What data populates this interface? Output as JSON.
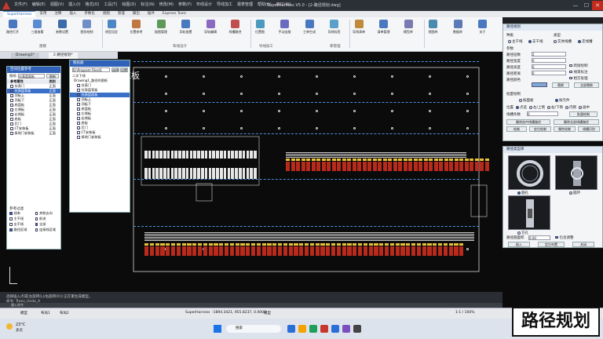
{
  "app": {
    "title": "SuperHarness V5.0 - [2-路径规划.dwg]",
    "menu": [
      "文件(F)",
      "编辑(E)",
      "视图(V)",
      "插入(I)",
      "格式(O)",
      "工具(T)",
      "绘图(D)",
      "标注(N)",
      "修改(M)",
      "参数(P)",
      "布线设计",
      "导线加工",
      "报表管理",
      "帮助(H)",
      "窗口(W)"
    ],
    "window_controls": [
      "—",
      "☐",
      "✕"
    ]
  },
  "ribbon": {
    "tabs": [
      "SuperHarness",
      "常用",
      "注释",
      "插入",
      "参数化",
      "视图",
      "管理",
      "输出",
      "插件",
      "Express Tools"
    ],
    "active_tab": "SuperHarness",
    "buttons": [
      "路径打开",
      "三维查看",
      "参数设置",
      "图形绘制",
      "线型设定",
      "位置参考",
      "插图管理",
      "导轨放置",
      "导轨编辑",
      "线槽路径",
      "位置图",
      "手动连接",
      "工单生成",
      "导线标签",
      "导线清单",
      "清单管理",
      "模型库",
      "视图库",
      "数据库",
      "关于"
    ],
    "groups": [
      "建模",
      "布线设计",
      "导线加工",
      "库管理"
    ]
  },
  "doc_tabs": [
    "Drawing1*",
    "2-路径规划*"
  ],
  "canvas": {
    "title_text": "底板",
    "crosshair_label": "Y"
  },
  "left_panel": {
    "title": "空间位置参考",
    "view_label": "图纸:",
    "view_value": "仪表盘面板",
    "refresh_btn": "刷新",
    "columns": [
      "参考属性",
      "类别"
    ],
    "rows": [
      {
        "name": "仪表门",
        "type": "正面"
      },
      {
        "name": "仪表盘背板",
        "type": "正面"
      },
      {
        "name": "顶板上",
        "type": "正面"
      },
      {
        "name": "顶板下",
        "type": "正面"
      },
      {
        "name": "底盘板",
        "type": "正面"
      },
      {
        "name": "左侧板",
        "type": "正面"
      },
      {
        "name": "右侧板",
        "type": "正面"
      },
      {
        "name": "底板",
        "type": "正面"
      },
      {
        "name": "后门",
        "type": "正面"
      },
      {
        "name": "CT安装板",
        "type": "正面"
      },
      {
        "name": "接地门安装板",
        "type": "正面"
      }
    ],
    "selected_index": 1,
    "filter_title": "参考过滤",
    "filters": [
      {
        "label": "线束",
        "checked": true
      },
      {
        "label": "关联去向",
        "checked": false
      },
      {
        "label": "主干线",
        "checked": false
      },
      {
        "label": "前进",
        "checked": false
      },
      {
        "label": "支干线",
        "checked": false
      },
      {
        "label": "全部",
        "checked": true
      },
      {
        "label": "路径区域",
        "checked": true
      },
      {
        "label": "连接线区域",
        "checked": false
      }
    ]
  },
  "layer_panel": {
    "title": "图层器",
    "path_label": "D:\\Program Files\\S",
    "browse": "选择",
    "settings": "设置",
    "root": "Drawing1_路径的图纸",
    "items": [
      "仪表门",
      "仪表盘背板",
      "仪表盘面板",
      "顶板上",
      "顶板下",
      "底盘板",
      "左侧板",
      "右侧板",
      "底板",
      "后门",
      "CT安装板",
      "接地门安装板"
    ],
    "selected_index": 2,
    "header": "二次下线"
  },
  "right_panel": {
    "title": "路径规划",
    "type_label": "种类",
    "kind_label": "类型",
    "kinds": [
      {
        "label": "主干线",
        "on": false
      },
      {
        "label": "支干线",
        "on": true
      }
    ],
    "types": [
      {
        "label": "实体线槽",
        "on": false
      },
      {
        "label": "走线槽",
        "on": true
      }
    ],
    "params_label": "参数",
    "fields": [
      {
        "label": "路径层数",
        "value": "2"
      },
      {
        "label": "路径宽度",
        "value": "0"
      },
      {
        "label": "路径高度",
        "value": "0"
      },
      {
        "label": "路径距离",
        "value": "0"
      },
      {
        "label": "路径颜色",
        "value": ""
      }
    ],
    "checks": [
      "跨接绘制",
      "线束标注",
      "相交处理"
    ],
    "color_btn": "替换",
    "replace_all_btn": "全部替换",
    "draw_label": "批量绘制",
    "draw_opts": [
      {
        "label": "按面板",
        "on": false
      },
      {
        "label": "按元件",
        "on": true
      }
    ],
    "pos_label": "位置",
    "pos_opts": [
      "点选",
      "左/上侧",
      "右/下侧",
      "内侧",
      "居中"
    ],
    "pos_on": "点选",
    "wire_count_label": "线槽条数",
    "wire_count": "0",
    "batch_btn": "批量绘制",
    "actions": [
      "删除选中线槽路径",
      "删除全部线槽路径",
      "绘制",
      "定位绘制",
      "属性绘制",
      "线槽识别"
    ]
  },
  "image_panel": {
    "title": "路径类型库",
    "options": [
      {
        "label": "圆孔",
        "on": true
      },
      {
        "label": "圆环",
        "on": false
      },
      {
        "label": "方孔",
        "on": false
      }
    ],
    "size_label": "路径圆面积",
    "size_value": "0.00",
    "bind_check": "包含调整",
    "buttons": [
      "插入",
      "定位布置",
      "关闭"
    ]
  },
  "command": {
    "line1": "选择插入点或[左旋转(L)/右旋转(R)]:正在重生成模型。",
    "line2": "命令: Trans_Undo_A",
    "prompt": "键入命令"
  },
  "status": {
    "tabs": [
      "模型",
      "布局1",
      "布局2"
    ],
    "app": "SuperHarness",
    "coords": "-1894.3421, 955.8237, 0.0000",
    "mode": "模型",
    "scale": "1:1 / 100%"
  },
  "taskbar": {
    "weather_temp": "23°C",
    "weather_text": "多云",
    "search_placeholder": "搜索",
    "time": "",
    "date": ""
  },
  "overlay_badge": "路径规划"
}
